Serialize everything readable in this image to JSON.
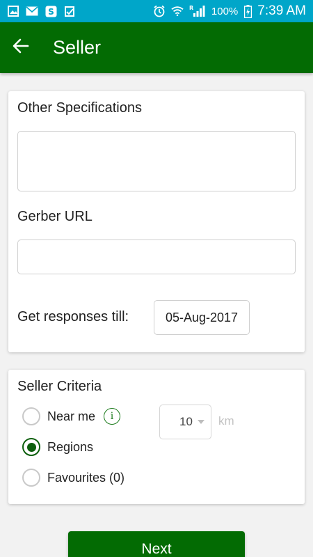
{
  "status_bar": {
    "left_icons": [
      "gallery-icon",
      "mail-icon",
      "s-app-icon",
      "clipboard-check-icon"
    ],
    "battery_text": "100%",
    "time": "7:39 AM",
    "background_color": "#00a6c9"
  },
  "app_bar": {
    "title": "Seller",
    "back_icon": "arrow-left-icon",
    "background_color": "#036b03"
  },
  "form": {
    "other_specifications_label": "Other Specifications",
    "other_specifications_value": "",
    "gerber_url_label": "Gerber URL",
    "gerber_url_value": "",
    "responses_till_label": "Get responses till:",
    "responses_till_value": "05-Aug-2017"
  },
  "seller_criteria": {
    "title": "Seller Criteria",
    "options": [
      {
        "label": "Near me",
        "selected": false
      },
      {
        "label": "Regions",
        "selected": true
      },
      {
        "label": "Favourites (0)",
        "selected": false
      }
    ],
    "info_icon": "info-icon",
    "distance_value": "10",
    "distance_unit": "km"
  },
  "next_button": {
    "label": "Next"
  }
}
